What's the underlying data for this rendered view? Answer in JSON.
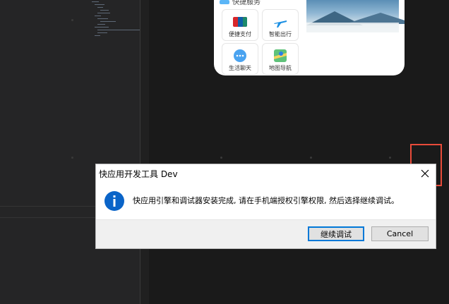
{
  "dialog": {
    "title": "快应用开发工具 Dev",
    "message": "快应用引擎和调试器安装完成, 请在手机端授权引擎权限, 然后选择继续调试。",
    "primary_button": "继续调试",
    "secondary_button": "Cancel",
    "icon": "info-icon",
    "close_icon": "close-icon"
  },
  "phone_preview": {
    "section_label": "快捷服务",
    "tiles": [
      {
        "label": "便捷支付",
        "icon": "unionpay-card-icon"
      },
      {
        "label": "智能出行",
        "icon": "airplane-icon"
      },
      {
        "label": "生活聊天",
        "icon": "chat-bubble-icon"
      },
      {
        "label": "地图导航",
        "icon": "map-icon"
      }
    ]
  },
  "colors": {
    "highlight": "#e84b3a",
    "accent": "#0078d7",
    "info_blue": "#0a64c8",
    "background": "#1e1e1e"
  }
}
